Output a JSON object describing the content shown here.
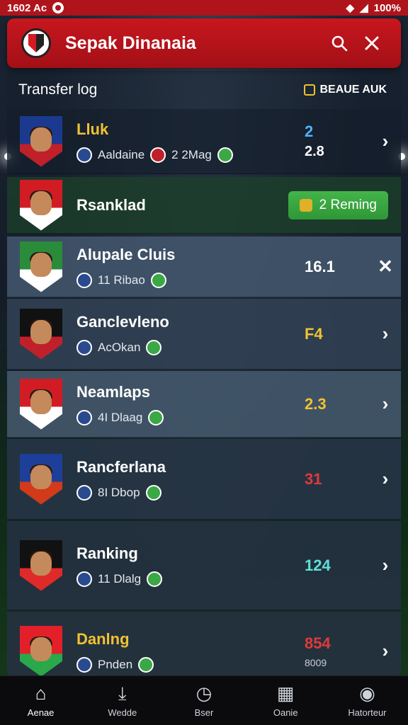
{
  "status_bar": {
    "time": "1602 Ac",
    "battery": "100%"
  },
  "app_bar": {
    "title": "Sepak Dinanaia",
    "search_icon": "search-icon",
    "close_icon": "close-icon"
  },
  "panel": {
    "title": "Transfer log",
    "badge": "BEAUE AUK"
  },
  "rows": [
    {
      "name": "Lluk",
      "name_color": "#f2c230",
      "meta": [
        "Aaldaine",
        "2 2Mag"
      ],
      "score_top": "2",
      "score_bottom": "2.8",
      "score_color": "#4fb3ff",
      "bg": "rgba(20,30,44,0.6)",
      "crest_colors": [
        "#1b3a8f",
        "#c0202a"
      ]
    },
    {
      "name": "Rsanklad",
      "name_color": "#ffffff",
      "meta": [],
      "button": "2 Reming",
      "bg": "rgba(28,66,42,0.75)",
      "crest_colors": [
        "#d21c24",
        "#ffffff"
      ]
    },
    {
      "name": "Alupale Cluis",
      "name_color": "#ffffff",
      "meta": [
        "11 Ribao"
      ],
      "score_top": "16.1",
      "score_bottom": "",
      "score_color": "#ffffff",
      "bg": "rgba(68,88,110,0.85)",
      "crest_colors": [
        "#2a8b3a",
        "#ffffff"
      ],
      "action": "close"
    },
    {
      "name": "Ganclevleno",
      "name_color": "#ffffff",
      "meta": [
        "AcOkan"
      ],
      "score_top": "F4",
      "score_bottom": "",
      "score_color": "#f2c230",
      "bg": "rgba(50,66,86,0.85)",
      "crest_colors": [
        "#111111",
        "#c0202a"
      ]
    },
    {
      "name": "Neamlaps",
      "name_color": "#ffffff",
      "meta": [
        "4I Dlaag"
      ],
      "score_top": "2.3",
      "score_bottom": "",
      "score_color": "#f2c230",
      "bg": "rgba(70,90,112,0.85)",
      "crest_colors": [
        "#d21c24",
        "#ffffff"
      ]
    },
    {
      "name": "Rancferlana",
      "name_color": "#ffffff",
      "meta": [
        "8I Dbop"
      ],
      "score_top": "31",
      "score_bottom": "",
      "score_color": "#e03a3a",
      "bg": "rgba(40,54,72,0.85)",
      "crest_colors": [
        "#1d3f9a",
        "#d23a1a"
      ]
    },
    {
      "name": "Ranking",
      "name_color": "#ffffff",
      "meta": [
        "11 Dlalg"
      ],
      "score_top": "124",
      "score_bottom": "",
      "score_color": "#5fe0d8",
      "bg": "rgba(38,50,66,0.85)",
      "crest_colors": [
        "#111111",
        "#e02a2a"
      ]
    },
    {
      "name": "Danlng",
      "name_color": "#f2c230",
      "meta": [
        "Pnden"
      ],
      "score_top": "854",
      "score_bottom": "",
      "score_color": "#e03a3a",
      "bg": "rgba(38,50,66,0.85)",
      "crest_colors": [
        "#e3202a",
        "#2aa84a"
      ],
      "footnote": "8009"
    }
  ],
  "bottom_nav": [
    {
      "label": "Aenae",
      "icon": "home-icon"
    },
    {
      "label": "Wedde",
      "icon": "download-icon"
    },
    {
      "label": "Bser",
      "icon": "timer-icon"
    },
    {
      "label": "Oanie",
      "icon": "calendar-icon"
    },
    {
      "label": "Hatorteur",
      "icon": "profile-icon"
    }
  ]
}
